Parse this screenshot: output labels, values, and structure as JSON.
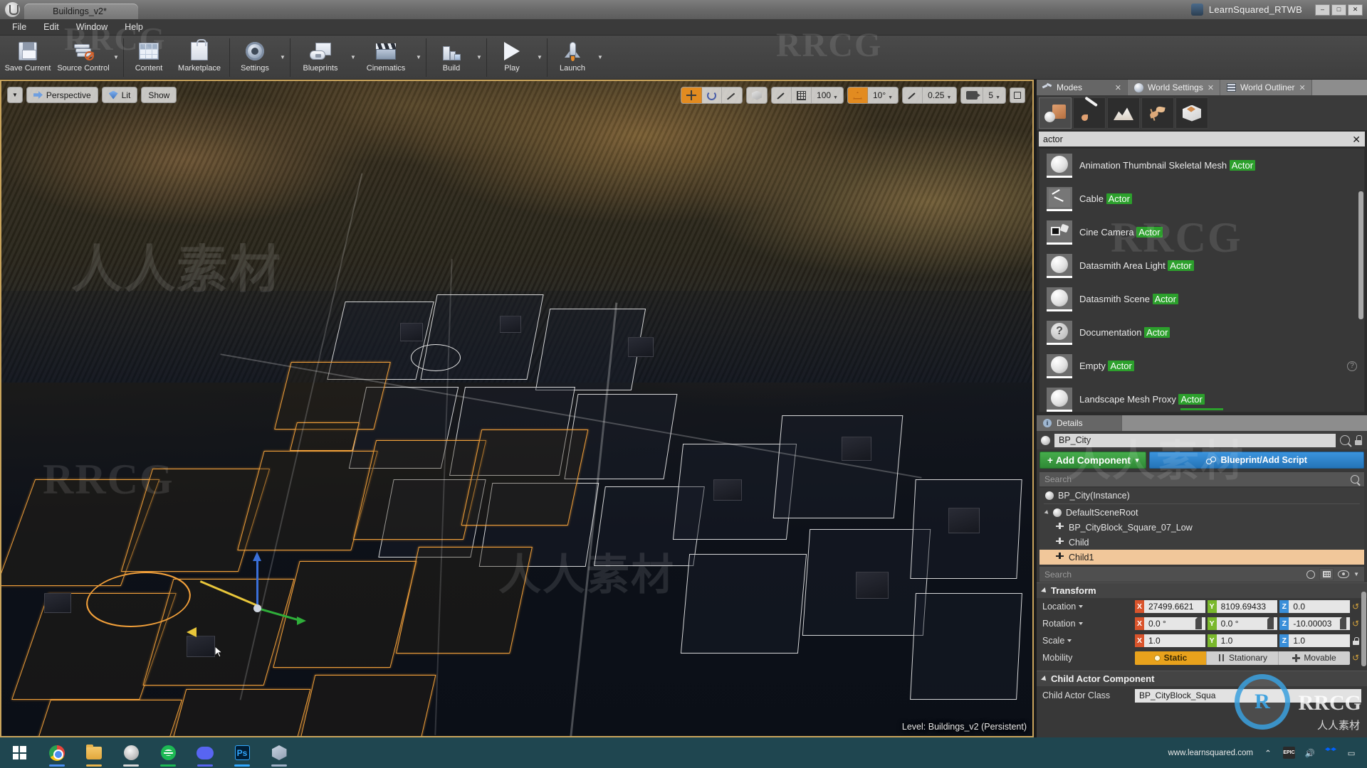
{
  "titlebar": {
    "document_tab": "Buildings_v2*",
    "project_name": "LearnSquared_RTWB",
    "minimize": "–",
    "maximize": "□",
    "close": "✕"
  },
  "menu": [
    "File",
    "Edit",
    "Window",
    "Help"
  ],
  "toolbar": [
    {
      "label": "Save Current",
      "icon": "floppy-disk-icon",
      "caret": false
    },
    {
      "label": "Source Control",
      "icon": "source-control-icon",
      "caret": true
    },
    {
      "label": "Content",
      "icon": "content-browser-icon",
      "caret": false
    },
    {
      "label": "Marketplace",
      "icon": "marketplace-bag-icon",
      "caret": false
    },
    {
      "label": "Settings",
      "icon": "gear-icon",
      "caret": true
    },
    {
      "label": "Blueprints",
      "icon": "blueprint-icon",
      "caret": true
    },
    {
      "label": "Cinematics",
      "icon": "clapperboard-icon",
      "caret": true
    },
    {
      "label": "Build",
      "icon": "build-icon",
      "caret": true
    },
    {
      "label": "Play",
      "icon": "play-icon",
      "caret": true
    },
    {
      "label": "Launch",
      "icon": "launch-rocket-icon",
      "caret": true
    }
  ],
  "viewport": {
    "left_chips": [
      {
        "label": "",
        "icon": "chevron-down-icon"
      },
      {
        "label": "Perspective",
        "icon": "camera-icon"
      },
      {
        "label": "Lit",
        "icon": "lit-shading-icon"
      },
      {
        "label": "Show",
        "icon": ""
      }
    ],
    "transform_tools": [
      "move-tool-icon",
      "rotate-tool-icon",
      "scale-tool-icon"
    ],
    "coord_space": "world-space-icon",
    "grid_snap": {
      "icon": "grid-snap-icon",
      "value": "100"
    },
    "angle_snap": {
      "icon": "angle-snap-icon",
      "value": "10°",
      "active": true
    },
    "scale_snap": {
      "icon": "scale-snap-icon",
      "value": "0.25"
    },
    "camera_speed": {
      "icon": "camera-speed-icon",
      "value": "5"
    },
    "maximize": "maximize-viewport-icon",
    "status": "Level:  Buildings_v2 (Persistent)"
  },
  "panels": {
    "tabs": [
      {
        "label": "Modes",
        "icon": "modes-icon",
        "active": true
      },
      {
        "label": "World Settings",
        "icon": "world-settings-icon",
        "active": false
      },
      {
        "label": "World Outliner",
        "icon": "world-outliner-icon",
        "active": false
      }
    ],
    "modes": [
      {
        "name": "place-mode",
        "active": true
      },
      {
        "name": "paint-mode",
        "active": false
      },
      {
        "name": "landscape-mode",
        "active": false
      },
      {
        "name": "foliage-mode",
        "active": false
      },
      {
        "name": "geometry-editing-mode",
        "active": false
      }
    ],
    "search": {
      "value": "actor",
      "clear": "✕"
    },
    "actor_items": [
      {
        "name": "Animation Thumbnail Skeletal Mesh ",
        "highlight": "Actor",
        "icon": "sphere-thumb"
      },
      {
        "name": "Cable ",
        "highlight": "Actor",
        "icon": "cable-thumb"
      },
      {
        "name": "Cine Camera ",
        "highlight": "Actor",
        "icon": "camera-thumb"
      },
      {
        "name": "Datasmith Area Light ",
        "highlight": "Actor",
        "icon": "sphere-thumb"
      },
      {
        "name": "Datasmith Scene ",
        "highlight": "Actor",
        "icon": "sphere-thumb"
      },
      {
        "name": "Documentation ",
        "highlight": "Actor",
        "icon": "question-thumb"
      },
      {
        "name": "Empty ",
        "highlight": "Actor",
        "icon": "sphere-thumb",
        "help": "?"
      },
      {
        "name": "Landscape Mesh Proxy ",
        "highlight": "Actor",
        "icon": "sphere-thumb"
      }
    ]
  },
  "details": {
    "tab_label": "Details",
    "actor_name": "BP_City",
    "add_component_label": "Add Component",
    "add_component_plus": "+",
    "blueprint_label": "Blueprint/Add Script",
    "search_placeholder": "Search",
    "component_tree": [
      {
        "label": "BP_City(Instance)",
        "icon": "sphere-icon",
        "indent": 0,
        "selected": false
      },
      {
        "label": "DefaultSceneRoot",
        "icon": "scene-root-icon",
        "indent": 0,
        "selected": false,
        "expander": true
      },
      {
        "label": "BP_CityBlock_Square_07_Low",
        "icon": "child-actor-icon",
        "indent": 1,
        "selected": false
      },
      {
        "label": "Child",
        "icon": "child-actor-icon",
        "indent": 1,
        "selected": false
      },
      {
        "label": "Child1",
        "icon": "child-actor-icon",
        "indent": 1,
        "selected": true
      }
    ],
    "prop_search_placeholder": "Search",
    "transform": {
      "section_title": "Transform",
      "location": {
        "label": "Location",
        "x": "27499.6621",
        "y": "8109.69433",
        "z": "0.0"
      },
      "rotation": {
        "label": "Rotation",
        "x": "0.0 °",
        "y": "0.0 °",
        "z": "-10.00003"
      },
      "scale": {
        "label": "Scale",
        "x": "1.0",
        "y": "1.0",
        "z": "1.0"
      },
      "mobility": {
        "label": "Mobility",
        "options": [
          "Static",
          "Stationary",
          "Movable"
        ],
        "selected": "Static"
      }
    },
    "child_actor_component": {
      "section_title": "Child Actor Component",
      "class_label": "Child Actor Class",
      "class_value": "BP_CityBlock_Squa"
    }
  },
  "taskbar": {
    "items": [
      {
        "name": "start-button",
        "icon": "windows-logo-icon"
      },
      {
        "name": "chrome-task",
        "icon": "chrome-icon",
        "accent": "#4a8df0"
      },
      {
        "name": "file-explorer-task",
        "icon": "folder-icon",
        "accent": "#e8b34c"
      },
      {
        "name": "unreal-editor-task",
        "icon": "unreal-icon",
        "accent": "#d8d8d8"
      },
      {
        "name": "spotify-task",
        "icon": "spotify-icon",
        "accent": "#1db954"
      },
      {
        "name": "discord-task",
        "icon": "discord-icon",
        "accent": "#5865f2"
      },
      {
        "name": "photoshop-task",
        "icon": "photoshop-icon",
        "accent": "#31a8ff"
      },
      {
        "name": "3d-viewer-task",
        "icon": "cube-icon",
        "accent": "#9fb0c6"
      }
    ],
    "url_text": "www.learnsquared.com",
    "tray": [
      "chevron-up-icon",
      "epic-games-icon",
      "volume-icon",
      "dropbox-icon",
      "action-center-icon"
    ]
  },
  "watermarks": {
    "rrcg": "RRCG",
    "logo_mark": "R",
    "chinese": "人人素材"
  }
}
